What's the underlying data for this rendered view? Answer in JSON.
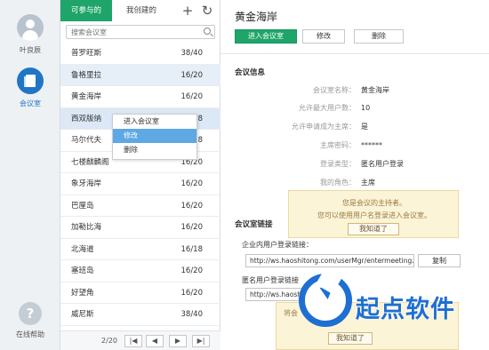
{
  "rail": {
    "contacts_label": "叶良辰",
    "meetings_label": "会议室",
    "help_label": "在线帮助"
  },
  "list": {
    "tabs": [
      "可参与的",
      "我创建的"
    ],
    "search_placeholder": "搜索会议室",
    "rooms": [
      {
        "name": "普罗旺斯",
        "count": "38/40"
      },
      {
        "name": "鲁格里拉",
        "count": "16/20"
      },
      {
        "name": "黄金海岸",
        "count": "16/20"
      },
      {
        "name": "西双版纳",
        "count": "18"
      },
      {
        "name": "马尔代夫",
        "count": "18"
      },
      {
        "name": "七楼麒麟阁",
        "count": "16/20"
      },
      {
        "name": "象牙海岸",
        "count": "16/20"
      },
      {
        "name": "巴厘岛",
        "count": "16/20"
      },
      {
        "name": "加勒比海",
        "count": "16/20"
      },
      {
        "name": "北海道",
        "count": "16/18"
      },
      {
        "name": "塞班岛",
        "count": "16/20"
      },
      {
        "name": "好望角",
        "count": "16/20"
      },
      {
        "name": "威尼斯",
        "count": "38/40"
      }
    ],
    "page_info": "2/20",
    "pager_icons": [
      "first-page-icon",
      "prev-page-icon",
      "next-page-icon",
      "last-page-icon"
    ]
  },
  "context_menu": {
    "items": [
      "进入会议室",
      "修改",
      "删除"
    ]
  },
  "detail": {
    "title": "黄金海岸",
    "buttons": {
      "enter": "进入会议室",
      "edit": "修改",
      "delete": "删除"
    },
    "info_section": "会议信息",
    "fields": [
      {
        "key": "会议室名称：",
        "value": "黄金海岸"
      },
      {
        "key": "允许最大用户数：",
        "value": "10"
      },
      {
        "key": "允许申请成为主席：",
        "value": "是"
      },
      {
        "key": "主席密码：",
        "value": "******"
      },
      {
        "key": "登录类型：",
        "value": "匿名用户登录"
      },
      {
        "key": "我的角色：",
        "value": "主席"
      }
    ],
    "tip": {
      "line1": "您是会议的主持者。",
      "line2": "您可以使用用户名登录进入会议室。",
      "button": "我知道了"
    },
    "link_section": "会议室链接",
    "internal_label": "企业内用户登录链接：",
    "internal_url": "http://ws.haoshitong.com/userMgr/entermeeting...",
    "copy_label": "复制",
    "anon_label": "匿名用户登录链接",
    "anon_url": "http://ws.haosh",
    "tip2": {
      "line": "将会",
      "button": "我知道了"
    }
  },
  "watermark": {
    "text": "起点软件"
  },
  "colors": {
    "brand_green": "#1fa56a",
    "accent_blue": "#1f76c6",
    "selected_row": "#dce8f6",
    "tip_bg": "#fbf4d7"
  }
}
